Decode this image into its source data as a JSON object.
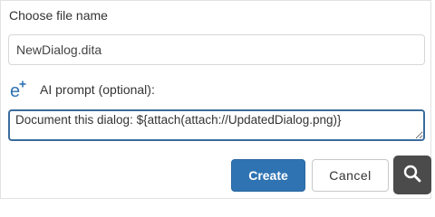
{
  "dialog": {
    "filename_label": "Choose file name",
    "filename_value": "NewDialog.dita",
    "ai_prompt_label": "AI prompt (optional):",
    "ai_prompt_value": "Document this dialog: ${attach(attach://UpdatedDialog.png)}",
    "create_label": "Create",
    "cancel_label": "Cancel"
  },
  "icons": {
    "ai": "ai-e-plus-icon",
    "search": "search-icon"
  },
  "colors": {
    "accent": "#2f73b2",
    "focus_border": "#3a6c9c",
    "search_button": "#4b4b4b"
  }
}
